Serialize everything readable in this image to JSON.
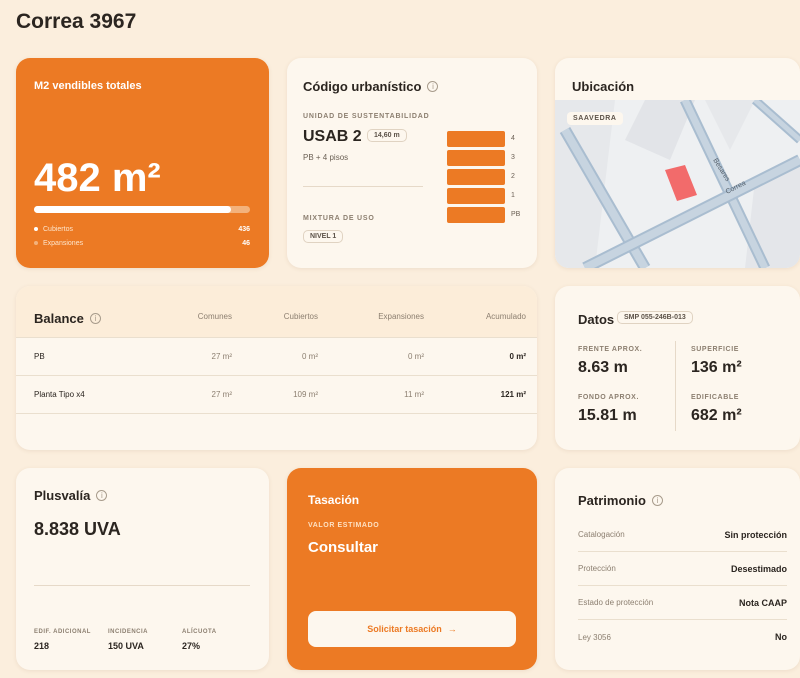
{
  "page": {
    "title": "Correa 3967"
  },
  "m2_card": {
    "label": "M2 vendibles totales",
    "value": "482 m²",
    "bar_fraction": 0.91,
    "rows": [
      {
        "label": "Cubiertos",
        "value": "436"
      },
      {
        "label": "Expansiones",
        "value": "46"
      }
    ]
  },
  "codigo": {
    "title": "Código urbanístico",
    "unit_label": "UNIDAD DE SUSTENTABILIDAD",
    "unit_value": "USAB 2",
    "height_pill": "14,60 m",
    "pisos": "PB + 4 pisos",
    "mixtura_label": "MIXTURA DE USO",
    "nivel": "NIVEL 1",
    "floors": [
      "4",
      "3",
      "2",
      "1",
      "PB"
    ]
  },
  "ubicacion": {
    "title": "Ubicación",
    "badge": "SAAVEDRA",
    "street1": "Besares",
    "street2": "Correa"
  },
  "balance": {
    "title": "Balance",
    "columns": [
      "Comunes",
      "Cubiertos",
      "Expansiones",
      "Acumulado"
    ],
    "rows": [
      {
        "name": "PB",
        "comunes": "27 m²",
        "cubiertos": "0 m²",
        "expansiones": "0 m²",
        "acumulado": "0 m²"
      },
      {
        "name": "Planta Tipo x4",
        "comunes": "27 m²",
        "cubiertos": "109 m²",
        "expansiones": "11 m²",
        "acumulado": "121 m²"
      }
    ]
  },
  "datos": {
    "title": "Datos",
    "smp": "SMP 055-246B-013",
    "frente_label": "FRENTE APROX.",
    "frente_value": "8.63 m",
    "superficie_label": "SUPERFICIE",
    "superficie_value": "136 m²",
    "fondo_label": "FONDO APROX.",
    "fondo_value": "15.81 m",
    "edificable_label": "EDIFICABLE",
    "edificable_value": "682 m²"
  },
  "plusvalia": {
    "title": "Plusvalía",
    "value": "8.838 UVA",
    "stats": [
      {
        "label": "EDIF. ADICIONAL",
        "value": "218"
      },
      {
        "label": "INCIDENCIA",
        "value": "150 UVA"
      },
      {
        "label": "ALÍCUOTA",
        "value": "27%"
      }
    ]
  },
  "tasacion": {
    "title": "Tasación",
    "sub": "VALOR ESTIMADO",
    "value": "Consultar",
    "button": "Solicitar tasación",
    "button_arrow": "→"
  },
  "patrimonio": {
    "title": "Patrimonio",
    "rows": [
      {
        "k": "Catalogación",
        "v": "Sin protección"
      },
      {
        "k": "Protección",
        "v": "Desestimado"
      },
      {
        "k": "Estado de protección",
        "v": "Nota CAAP"
      },
      {
        "k": "Ley 3056",
        "v": "No"
      }
    ]
  },
  "colors": {
    "accent": "#ec7a24",
    "background": "#fbeedd",
    "card": "#fdf7ee"
  }
}
